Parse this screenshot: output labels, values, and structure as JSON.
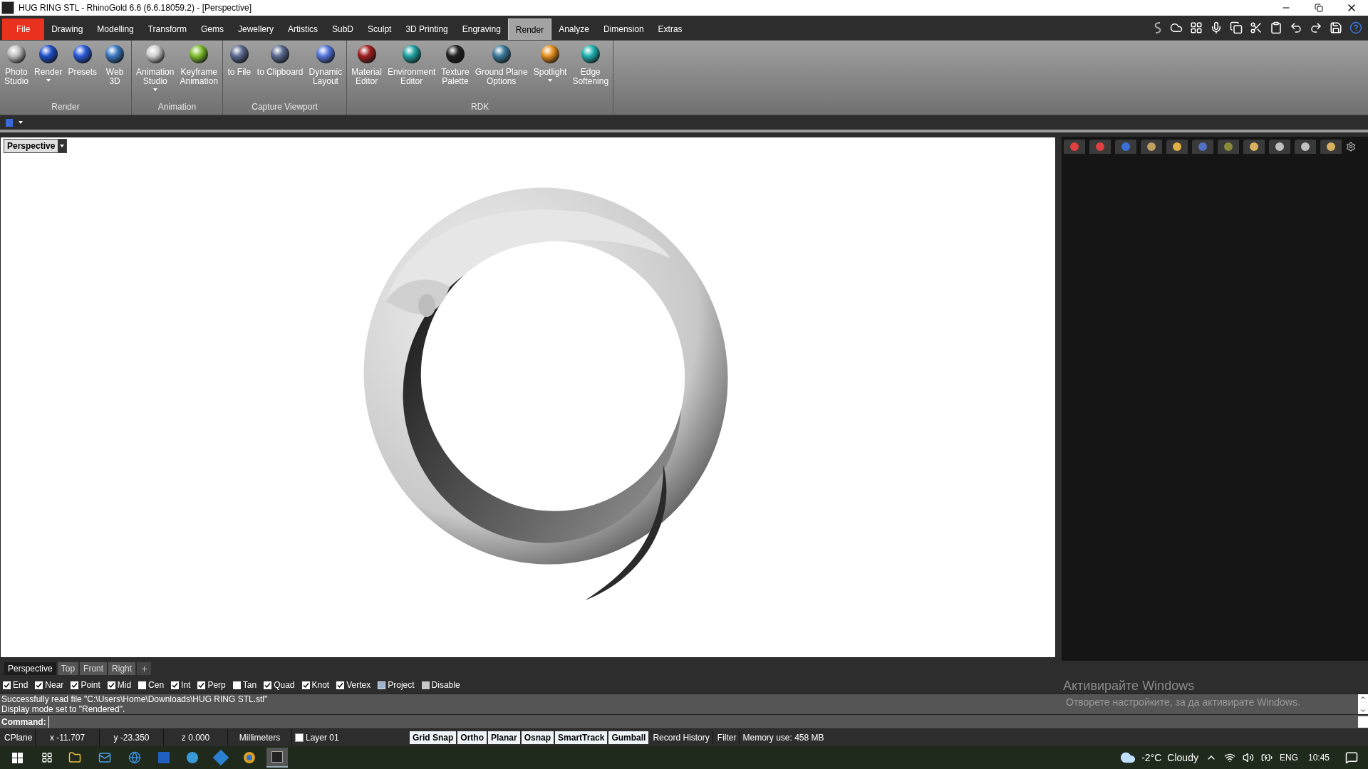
{
  "window": {
    "title": "HUG RING STL - RhinoGold 6.6 (6.6.18059.2) - [Perspective]"
  },
  "menu": [
    {
      "label": "File",
      "kind": "file",
      "selected": false
    },
    {
      "label": "Drawing",
      "kind": "tab",
      "selected": false
    },
    {
      "label": "Modelling",
      "kind": "tab",
      "selected": false
    },
    {
      "label": "Transform",
      "kind": "tab",
      "selected": false
    },
    {
      "label": "Gems",
      "kind": "tab",
      "selected": false
    },
    {
      "label": "Jewellery",
      "kind": "tab",
      "selected": false
    },
    {
      "label": "Artistics",
      "kind": "tab",
      "selected": false
    },
    {
      "label": "SubD",
      "kind": "tab",
      "selected": false
    },
    {
      "label": "Sculpt",
      "kind": "tab",
      "selected": false
    },
    {
      "label": "3D Printing",
      "kind": "tab",
      "selected": false
    },
    {
      "label": "Engraving",
      "kind": "tab",
      "selected": false
    },
    {
      "label": "Render",
      "kind": "tab",
      "selected": true
    },
    {
      "label": "Analyze",
      "kind": "tab",
      "selected": false
    },
    {
      "label": "Dimension",
      "kind": "tab",
      "selected": false
    },
    {
      "label": "Extras",
      "kind": "tab",
      "selected": false
    }
  ],
  "ribbon": [
    {
      "label": "Render",
      "buttons": [
        {
          "label": "Photo\nStudio",
          "dropdown": false
        },
        {
          "label": "Render",
          "dropdown": true
        },
        {
          "label": "Presets",
          "dropdown": false
        },
        {
          "label": "Web\n3D",
          "dropdown": false
        }
      ]
    },
    {
      "label": "Animation",
      "buttons": [
        {
          "label": "Animation\nStudio",
          "dropdown": true
        },
        {
          "label": "Keyframe\nAnimation",
          "dropdown": false
        }
      ]
    },
    {
      "label": "Capture Viewport",
      "buttons": [
        {
          "label": "to File",
          "dropdown": false
        },
        {
          "label": "to Clipboard",
          "dropdown": false
        },
        {
          "label": "Dynamic\nLayout",
          "dropdown": false
        }
      ]
    },
    {
      "label": "RDK",
      "buttons": [
        {
          "label": "Material\nEditor",
          "dropdown": false
        },
        {
          "label": "Environment\nEditor",
          "dropdown": false
        },
        {
          "label": "Texture\nPalette",
          "dropdown": false
        },
        {
          "label": "Ground Plane\nOptions",
          "dropdown": false
        },
        {
          "label": "Spotlight",
          "dropdown": true
        },
        {
          "label": "Edge\nSoftening",
          "dropdown": false
        }
      ]
    }
  ],
  "viewport": {
    "title": "Perspective"
  },
  "viewport_tabs": [
    {
      "label": "Perspective",
      "selected": true
    },
    {
      "label": "Top",
      "selected": false
    },
    {
      "label": "Front",
      "selected": false
    },
    {
      "label": "Right",
      "selected": false
    }
  ],
  "osnaps": [
    {
      "label": "End",
      "kind": "check",
      "checked": true
    },
    {
      "label": "Near",
      "kind": "check",
      "checked": true
    },
    {
      "label": "Point",
      "kind": "check",
      "checked": true
    },
    {
      "label": "Mid",
      "kind": "check",
      "checked": true
    },
    {
      "label": "Cen",
      "kind": "check",
      "checked": false
    },
    {
      "label": "Int",
      "kind": "check",
      "checked": true
    },
    {
      "label": "Perp",
      "kind": "check",
      "checked": true
    },
    {
      "label": "Tan",
      "kind": "check",
      "checked": false
    },
    {
      "label": "Quad",
      "kind": "check",
      "checked": true
    },
    {
      "label": "Knot",
      "kind": "check",
      "checked": true
    },
    {
      "label": "Vertex",
      "kind": "check",
      "checked": true
    },
    {
      "label": "Project",
      "kind": "mixed",
      "checked": false
    },
    {
      "label": "Disable",
      "kind": "greyed",
      "checked": false
    }
  ],
  "command_history": [
    "Successfully read file \"C:\\Users\\Home\\Downloads\\HUG RING STL.stl\"",
    "Display mode set to \"Rendered\"."
  ],
  "command_prompt": "Command:",
  "activation_notice": {
    "title": "Активирайте Windows",
    "text": "Отворете настройките, за да активирате Windows."
  },
  "status_bar": {
    "cells": [
      "CPlane",
      "x -11.707",
      "y -23.350",
      "z 0.000",
      "Millimeters"
    ],
    "layer": {
      "label": "Layer 01",
      "color": "#ffffff"
    },
    "toggles": [
      {
        "label": "Grid Snap",
        "on": true
      },
      {
        "label": "Ortho",
        "on": true
      },
      {
        "label": "Planar",
        "on": true
      },
      {
        "label": "Osnap",
        "on": true
      },
      {
        "label": "SmartTrack",
        "on": true
      },
      {
        "label": "Gumball",
        "on": true
      },
      {
        "label": "Record History",
        "on": false
      },
      {
        "label": "Filter",
        "on": false
      }
    ],
    "memory": "Memory use: 458 MB"
  },
  "taskbar": {
    "temperature": "-2°C",
    "weather": "Cloudy",
    "language": "ENG",
    "time": "10:45"
  }
}
